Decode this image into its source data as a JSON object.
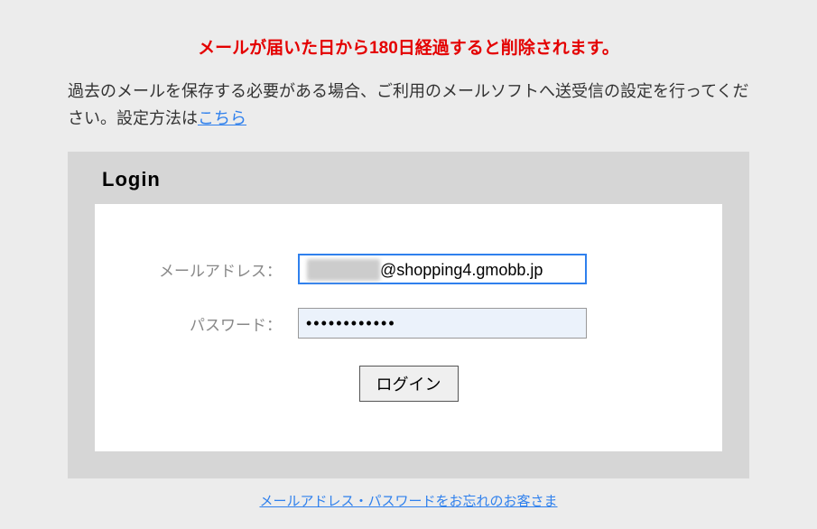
{
  "warning": "メールが届いた日から180日経過すると削除されます。",
  "info_text_1": "過去のメールを保存する必要がある場合、ご利用のメールソフトへ送受信の設定を行ってください。設定方法は",
  "info_link": "こちら",
  "login": {
    "title": "Login",
    "email_label": "メールアドレス：",
    "password_label": "パスワード：",
    "email_value": "@shopping4.gmobb.jp",
    "email_obscured_prefix": "xxxxxxxxx",
    "password_value": "••••••••••••",
    "button": "ログイン"
  },
  "forgot_link": "メールアドレス・パスワードをお忘れのお客さま"
}
